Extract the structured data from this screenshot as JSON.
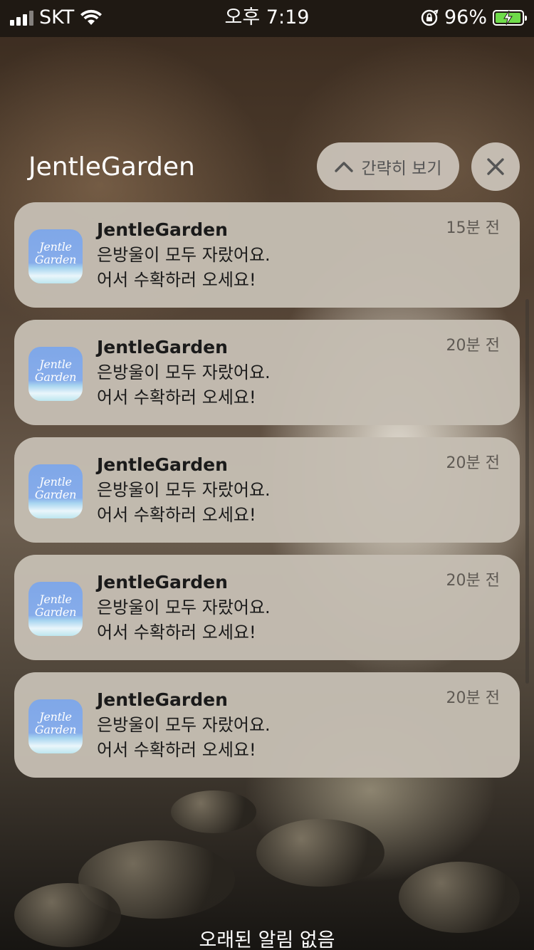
{
  "status_bar": {
    "carrier": "SKT",
    "time": "오후 7:19",
    "battery_percent": "96%",
    "battery_level": 0.96,
    "icons": [
      "signal-icon",
      "wifi-icon",
      "orientation-lock-icon",
      "battery-charging-icon"
    ]
  },
  "group": {
    "title": "JentleGarden",
    "collapse_label": "간략히 보기",
    "collapse_icon": "chevron-up-icon",
    "close_icon": "close-icon"
  },
  "notifications": [
    {
      "app": "JentleGarden",
      "time": "15분 전",
      "line1": "은방울이 모두 자랐어요.",
      "line2": "어서 수확하러 오세요!",
      "icon_text_1": "Jentle",
      "icon_text_2": "Garden"
    },
    {
      "app": "JentleGarden",
      "time": "20분 전",
      "line1": "은방울이 모두 자랐어요.",
      "line2": "어서 수확하러 오세요!",
      "icon_text_1": "Jentle",
      "icon_text_2": "Garden"
    },
    {
      "app": "JentleGarden",
      "time": "20분 전",
      "line1": "은방울이 모두 자랐어요.",
      "line2": "어서 수확하러 오세요!",
      "icon_text_1": "Jentle",
      "icon_text_2": "Garden"
    },
    {
      "app": "JentleGarden",
      "time": "20분 전",
      "line1": "은방울이 모두 자랐어요.",
      "line2": "어서 수확하러 오세요!",
      "icon_text_1": "Jentle",
      "icon_text_2": "Garden"
    },
    {
      "app": "JentleGarden",
      "time": "20분 전",
      "line1": "은방울이 모두 자랐어요.",
      "line2": "어서 수확하러 오세요!",
      "icon_text_1": "Jentle",
      "icon_text_2": "Garden"
    }
  ],
  "footer": {
    "text": "오래된 알림 없음"
  },
  "colors": {
    "card_background": "#c4bdb2",
    "battery_fill": "#6fdc4a",
    "app_icon_blue": "#86acea"
  }
}
